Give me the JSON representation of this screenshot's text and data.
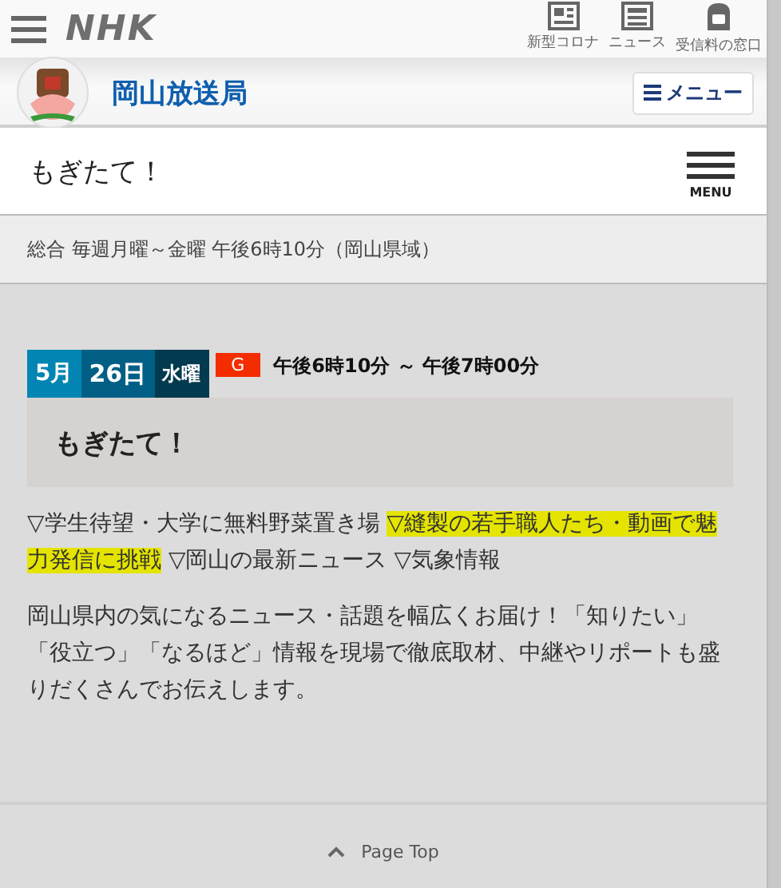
{
  "header": {
    "logo": "NHK",
    "links": [
      {
        "label": "新型コロナ",
        "kind": "corona"
      },
      {
        "label": "ニュース",
        "kind": "news"
      },
      {
        "label": "受信料の窓口",
        "kind": "fee"
      }
    ]
  },
  "station": {
    "name": "岡山放送局",
    "menu_button": "メニュー"
  },
  "program_header": {
    "title": "もぎたて！",
    "menu_label": "MENU"
  },
  "schedule": "総合 毎週月曜～金曜 午後6時10分（岡山県域）",
  "episode": {
    "month": "5月",
    "day": "26日",
    "weekday": "水曜",
    "channel": "G",
    "time": "午後6時10分 ～ 午後7時00分",
    "title": "もぎたて！"
  },
  "topics": [
    {
      "text": "▽学生待望・大学に無料野菜置き場",
      "highlighted": false
    },
    {
      "text": "▽縫製の若手職人たち・動画で魅力発信に挑戦",
      "highlighted": true
    },
    {
      "text": "▽岡山の最新ニュース",
      "highlighted": false
    },
    {
      "text": "▽気象情報",
      "highlighted": false
    }
  ],
  "description": "岡山県内の気になるニュース・話題を幅広くお届け！「知りたい」「役立つ」「なるほど」情報を現場で徹底取材、中継やリポートも盛りだくさんでお伝えします。",
  "page_top": "Page Top"
}
